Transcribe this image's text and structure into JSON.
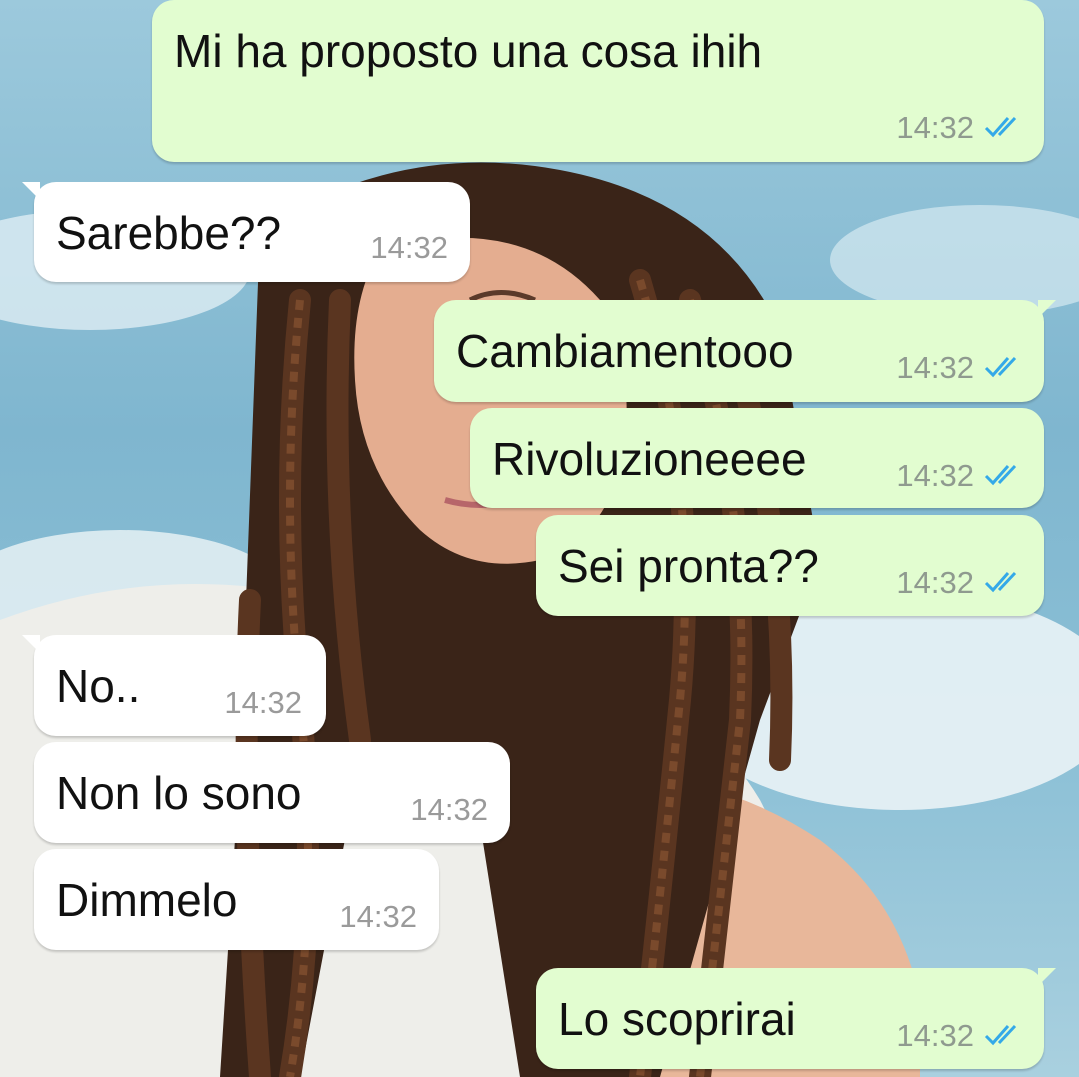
{
  "theme": {
    "incoming_bubble": "#ffffff",
    "outgoing_bubble": "#e2fdd0",
    "read_tick_color": "#34a9e8",
    "timestamp_color": "#8f9a8f"
  },
  "wallpaper": {
    "subject": "portrait photo of a woman with long braids against blue sky"
  },
  "messages": [
    {
      "direction": "out",
      "text": "Mi ha proposto una cosa ihih",
      "time": "14:32",
      "status": "read"
    },
    {
      "direction": "in",
      "text": "Sarebbe??",
      "time": "14:32"
    },
    {
      "direction": "out",
      "text": "Cambiamentooo",
      "time": "14:32",
      "status": "read"
    },
    {
      "direction": "out",
      "text": "Rivoluzioneeee",
      "time": "14:32",
      "status": "read"
    },
    {
      "direction": "out",
      "text": "Sei pronta??",
      "time": "14:32",
      "status": "read"
    },
    {
      "direction": "in",
      "text": "No..",
      "time": "14:32"
    },
    {
      "direction": "in",
      "text": "Non lo sono",
      "time": "14:32"
    },
    {
      "direction": "in",
      "text": "Dimmelo",
      "time": "14:32"
    },
    {
      "direction": "out",
      "text": "Lo scoprirai",
      "time": "14:32",
      "status": "read"
    }
  ]
}
